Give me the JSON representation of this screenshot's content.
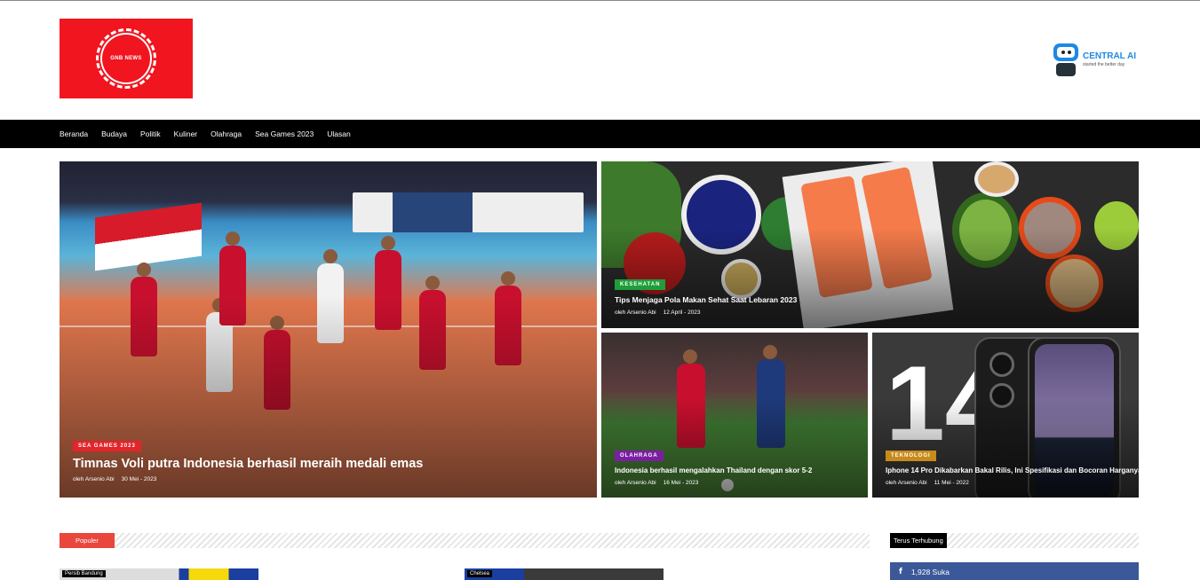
{
  "site": {
    "logo_text": "GNB NEWS"
  },
  "ad": {
    "title": "CENTRAL AI",
    "subtitle": "started the better day"
  },
  "nav": {
    "items": [
      "Beranda",
      "Budaya",
      "Politik",
      "Kuliner",
      "Olahraga",
      "Sea Games 2023",
      "Ulasan"
    ]
  },
  "featured": [
    {
      "category": "SEA GAMES 2023",
      "category_color": "#e3242b",
      "title": "Timnas Voli putra Indonesia berhasil meraih medali emas",
      "author": "oleh Arsenio Abi",
      "date": "30 Mei - 2023"
    },
    {
      "category": "KESEHATAN",
      "category_color": "#1f9d3a",
      "title": "Tips Menjaga Pola Makan Sehat Saat Lebaran 2023",
      "author": "oleh Arsenio Abi",
      "date": "12 April - 2023"
    },
    {
      "category": "OLAHRAGA",
      "category_color": "#7b1fa2",
      "title": "Indonesia berhasil mengalahkan Thailand dengan skor 5-2",
      "author": "oleh Arsenio Abi",
      "date": "16 Mei - 2023"
    },
    {
      "category": "TEKNOLOGI",
      "category_color": "#c98a1c",
      "title": "Iphone 14 Pro Dikabarkan Bakal Rilis, Ini Spesifikasi dan Bocoran Harganya",
      "author": "oleh Arsenio Abi",
      "date": "11 Mei - 2022"
    }
  ],
  "popular": {
    "label": "Populer",
    "items": [
      {
        "tag": "Persib Bandung"
      },
      {
        "tag": "Chelsea"
      }
    ]
  },
  "connect": {
    "label": "Terus Terhubung",
    "facebook_icon": "facebook-f-icon",
    "facebook_count": "1,928 Suka"
  }
}
